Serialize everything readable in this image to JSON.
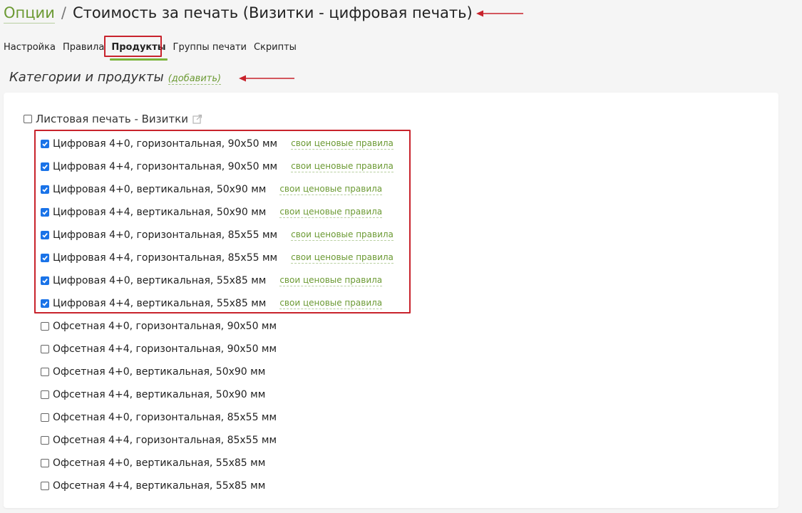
{
  "breadcrumb": {
    "root_label": "Опции",
    "separator": "/",
    "title": "Стоимость за печать (Визитки - цифровая печать)"
  },
  "tabs": [
    {
      "label": "Настройка",
      "active": false
    },
    {
      "label": "Правила",
      "active": false
    },
    {
      "label": "Продукты",
      "active": true
    },
    {
      "label": "Группы печати",
      "active": false
    },
    {
      "label": "Скрипты",
      "active": false
    }
  ],
  "section": {
    "title": "Категории и продукты",
    "add_label": "(добавить)"
  },
  "category": {
    "label": "Листовая печать - Визитки",
    "checked": false,
    "icon": "external-link-icon"
  },
  "rules_link_label": "свои ценовые правила",
  "products": [
    {
      "label": "Цифровая 4+0, горизонтальная, 90x50 мм",
      "checked": true
    },
    {
      "label": "Цифровая 4+4, горизонтальная, 90x50 мм",
      "checked": true
    },
    {
      "label": "Цифровая 4+0, вертикальная, 50x90 мм",
      "checked": true
    },
    {
      "label": "Цифровая 4+4, вертикальная, 50x90 мм",
      "checked": true
    },
    {
      "label": "Цифровая 4+0, горизонтальная, 85x55 мм",
      "checked": true
    },
    {
      "label": "Цифровая 4+4, горизонтальная, 85x55 мм",
      "checked": true
    },
    {
      "label": "Цифровая 4+0, вертикальная, 55x85 мм",
      "checked": true
    },
    {
      "label": "Цифровая 4+4, вертикальная, 55x85 мм",
      "checked": true
    },
    {
      "label": "Офсетная 4+0, горизонтальная, 90x50 мм",
      "checked": false
    },
    {
      "label": "Офсетная 4+4, горизонтальная, 90x50 мм",
      "checked": false
    },
    {
      "label": "Офсетная 4+0, вертикальная, 50x90 мм",
      "checked": false
    },
    {
      "label": "Офсетная 4+4, вертикальная, 50x90 мм",
      "checked": false
    },
    {
      "label": "Офсетная 4+0, горизонтальная, 85x55 мм",
      "checked": false
    },
    {
      "label": "Офсетная 4+4, горизонтальная, 85x55 мм",
      "checked": false
    },
    {
      "label": "Офсетная 4+0, вертикальная, 55x85 мм",
      "checked": false
    },
    {
      "label": "Офсетная 4+4, вертикальная, 55x85 мм",
      "checked": false
    }
  ],
  "colors": {
    "accent_green": "#6c9a34",
    "tab_underline": "#7bb33a",
    "annotation_red": "#c8232c",
    "checkbox_blue": "#1a73e8"
  }
}
